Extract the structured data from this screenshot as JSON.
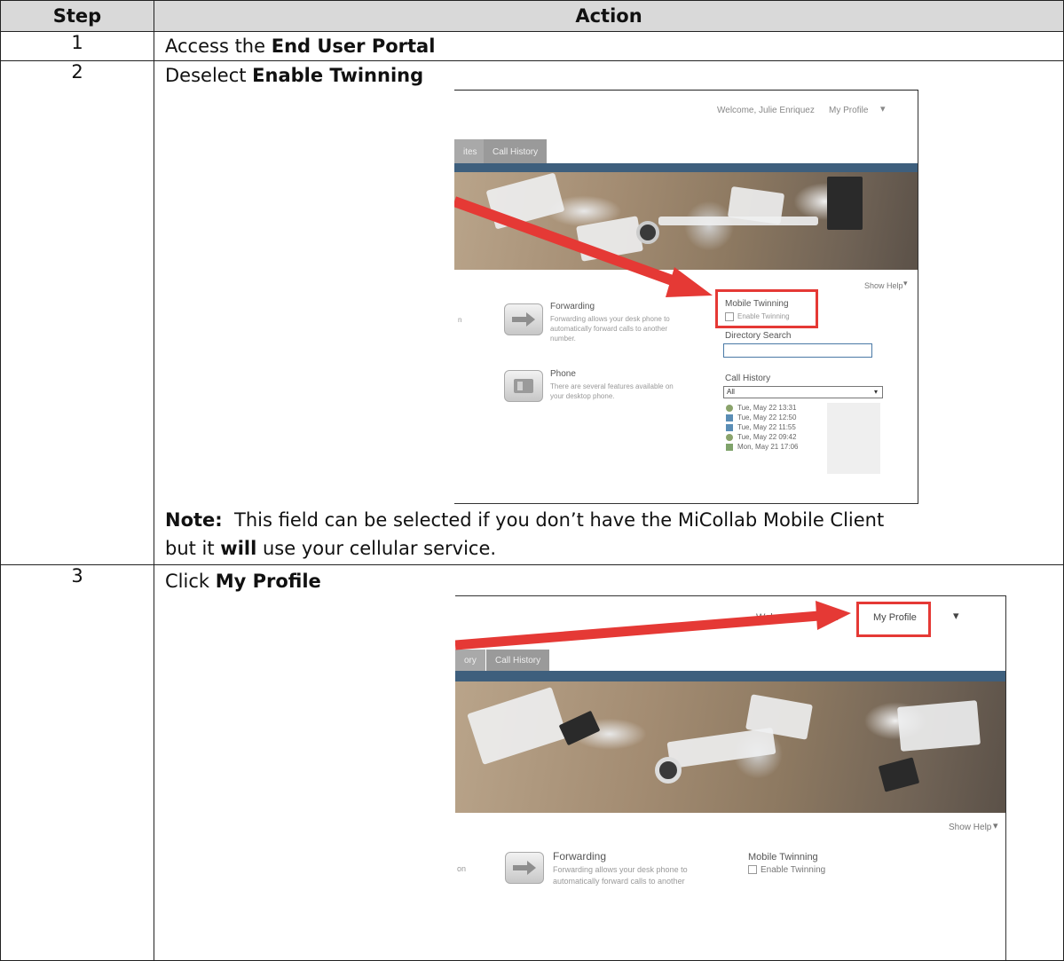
{
  "table": {
    "header_step": "Step",
    "header_action": "Action"
  },
  "rows": [
    {
      "step": "1",
      "prefix": "Access the ",
      "bold": "End User Portal"
    },
    {
      "step": "2",
      "prefix": "Deselect ",
      "bold": "Enable Twinning"
    },
    {
      "step": "3",
      "prefix": "Click ",
      "bold": "My Profile"
    }
  ],
  "note": {
    "label": "Note:",
    "text_a": "This field can be selected if you don’t have the MiCollab Mobile Client",
    "text_b": "but it ",
    "bold": "will",
    "text_c": " use your cellular service."
  },
  "shot1": {
    "welcome": "Welcome, Julie Enriquez",
    "my_profile": "My Profile",
    "tab_partial": "ites",
    "tab_call_history": "Call History",
    "show_help": "Show Help",
    "partial_left": "n",
    "forwarding_title": "Forwarding",
    "forwarding_desc": "Forwarding allows your desk phone to automatically forward calls to another number.",
    "phone_title": "Phone",
    "phone_desc": "There are several features available on your desktop phone.",
    "mobile_twinning": "Mobile Twinning",
    "enable_twinning": "Enable Twinning",
    "directory_search": "Directory Search",
    "call_history": "Call History",
    "select_value": "All",
    "history": [
      "Tue, May 22 13:31",
      "Tue, May 22 12:50",
      "Tue, May 22 11:55",
      "Tue, May 22 09:42",
      "Mon, May 21 17:06"
    ]
  },
  "shot2": {
    "welcome_a": "Welcome, J",
    "welcome_b": "ez",
    "my_profile": "My Profile",
    "tab_partial": "ory",
    "tab_call_history": "Call History",
    "show_help": "Show Help",
    "partial_left": "on",
    "forwarding_title": "Forwarding",
    "forwarding_desc": "Forwarding allows your desk phone to",
    "forwarding_desc2": "automatically forward calls to another",
    "mobile_twinning": "Mobile Twinning",
    "enable_twinning": "Enable Twinning"
  },
  "colors": {
    "accent_red": "#e53935",
    "banner_bar": "#3e5f7d",
    "header_gray": "#d9d9d9"
  }
}
